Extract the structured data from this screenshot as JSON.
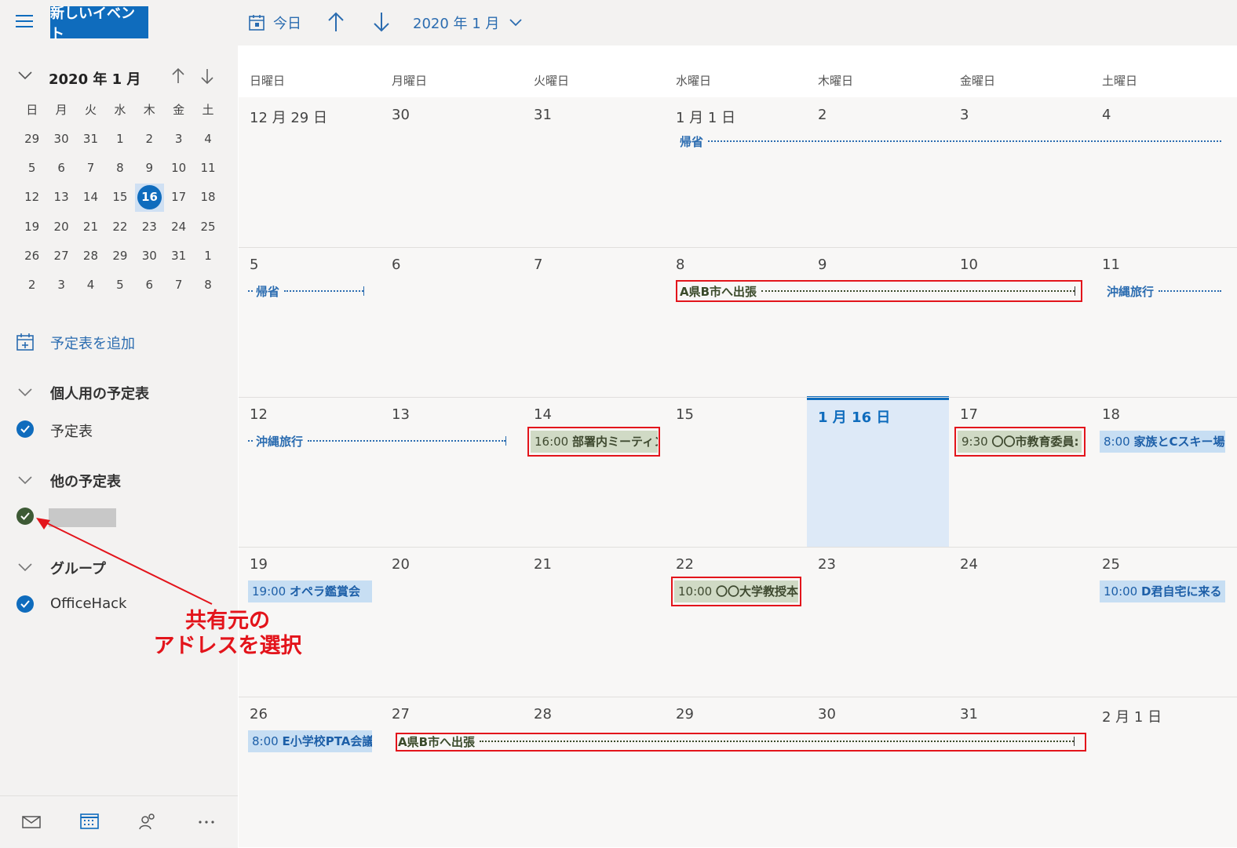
{
  "toolbar": {
    "new_event_label": "新しいイベント",
    "today_label": "今日",
    "month_label": "2020 年 1 月"
  },
  "mini_calendar": {
    "title": "2020 年 1 月",
    "weekdays": [
      "日",
      "月",
      "火",
      "水",
      "木",
      "金",
      "土"
    ],
    "weeks": [
      [
        "29",
        "30",
        "31",
        "1",
        "2",
        "3",
        "4"
      ],
      [
        "5",
        "6",
        "7",
        "8",
        "9",
        "10",
        "11"
      ],
      [
        "12",
        "13",
        "14",
        "15",
        "16",
        "17",
        "18"
      ],
      [
        "19",
        "20",
        "21",
        "22",
        "23",
        "24",
        "25"
      ],
      [
        "26",
        "27",
        "28",
        "29",
        "30",
        "31",
        "1"
      ],
      [
        "2",
        "3",
        "4",
        "5",
        "6",
        "7",
        "8"
      ]
    ],
    "today": "16"
  },
  "sidebar": {
    "add_calendar": "予定表を追加",
    "personal_heading": "個人用の予定表",
    "personal_item": "予定表",
    "other_heading": "他の予定表",
    "group_heading": "グループ",
    "group_item": "OfficeHack",
    "colors": {
      "blue_check": "#0f6cbd",
      "green_check": "#3d5a35",
      "redacted": "#c8c8c8"
    }
  },
  "annotation": {
    "line1": "共有元の",
    "line2": "アドレスを選択",
    "color": "#e3141b"
  },
  "calendar": {
    "weekdays": [
      "日曜日",
      "月曜日",
      "火曜日",
      "水曜日",
      "木曜日",
      "金曜日",
      "土曜日"
    ],
    "weeks": [
      [
        "12 月 29 日",
        "30",
        "31",
        "1 月 1 日",
        "2",
        "3",
        "4"
      ],
      [
        "5",
        "6",
        "7",
        "8",
        "9",
        "10",
        "11"
      ],
      [
        "12",
        "13",
        "14",
        "15",
        "1 月 16 日",
        "17",
        "18"
      ],
      [
        "19",
        "20",
        "21",
        "22",
        "23",
        "24",
        "25"
      ],
      [
        "26",
        "27",
        "28",
        "29",
        "30",
        "31",
        "2 月 1 日"
      ]
    ],
    "events": {
      "kisei_1": "帰省",
      "kisei_2": "帰省",
      "trip_jan8": "A県B市へ出張",
      "okinawa_1": "沖縄旅行",
      "okinawa_2": "沖縄旅行",
      "meeting_14_time": "16:00",
      "meeting_14_title": "部署内ミーティン:",
      "edu_17_time": "9:30",
      "edu_17_title": "〇〇市教育委員:",
      "ski_18_time": "8:00",
      "ski_18_title": "家族とCスキー場",
      "opera_19_time": "19:00",
      "opera_19_title": "オペラ鑑賞会",
      "prof_22_time": "10:00",
      "prof_22_title": "〇〇大学教授本",
      "d_25_time": "10:00",
      "d_25_title": "D君自宅に来る",
      "pta_26_time": "8:00",
      "pta_26_title": "E小学校PTA会議",
      "trip_jan27": "A県B市へ出張"
    },
    "colors": {
      "accent": "#0f6cbd",
      "highlight": "#e3141b",
      "event_blue": "#c7def3",
      "event_green": "#d0dac5"
    }
  }
}
